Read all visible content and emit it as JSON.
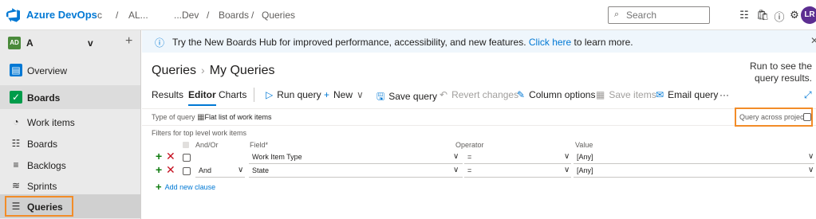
{
  "topbar": {
    "brand": "Azure DevOps",
    "org_fragment": "c",
    "crumb_sep": "/",
    "project_crumb": "AL...",
    "team_crumb": "...Dev",
    "boards_crumb": "Boards",
    "queries_crumb": "Queries",
    "search_placeholder": "Search",
    "avatar_initials": "LR"
  },
  "sidebar": {
    "project_badge": "AD",
    "project_name": "A",
    "project_name_tail": "v",
    "add_symbol": "+",
    "items": [
      {
        "label": "Overview"
      },
      {
        "label": "Boards"
      },
      {
        "label": "Work items"
      },
      {
        "label": "Boards"
      },
      {
        "label": "Backlogs"
      },
      {
        "label": "Sprints"
      },
      {
        "label": "Queries"
      }
    ]
  },
  "banner": {
    "message": "Try the New Boards Hub for improved performance, accessibility, and new features. ",
    "link": "Click here",
    "message_tail": " to learn more."
  },
  "page": {
    "root": "Queries",
    "current": "My Queries",
    "run_hint": "Run to see the query results."
  },
  "toolbar": {
    "tab_results": "Results",
    "tab_editor": "Editor",
    "tab_charts": "Charts",
    "run_query": "Run query",
    "new": "New",
    "save_query": "Save query",
    "revert_changes": "Revert changes",
    "column_options": "Column options",
    "save_items": "Save items",
    "email_query": "Email query",
    "more": "···"
  },
  "query_type": {
    "label": "Type of query",
    "value": "Flat list of work items",
    "across_projects_label": "Query across projects",
    "across_projects_checked": false
  },
  "filters": {
    "section_label": "Filters for top level work items",
    "columns": {
      "and_or": "And/Or",
      "field": "Field*",
      "operator": "Operator",
      "value": "Value"
    },
    "clauses": [
      {
        "and_or": "",
        "field": "Work Item Type",
        "operator": "=",
        "value": "[Any]"
      },
      {
        "and_or": "And",
        "field": "State",
        "operator": "=",
        "value": "[Any]"
      }
    ],
    "add_clause": "Add new clause"
  },
  "colors": {
    "accent": "#0078d4",
    "highlight": "#f28c28",
    "add_green": "#107c10",
    "delete_red": "#c50f1f",
    "avatar": "#5c2e91"
  }
}
